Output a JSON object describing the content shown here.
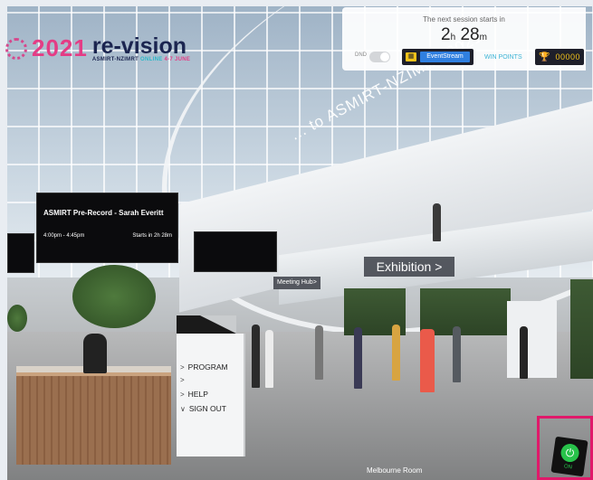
{
  "logo": {
    "year": "2021",
    "brand": "re-vision",
    "sub_org": "ASMIRT-NZIMRT",
    "sub_online": "ONLINE",
    "sub_dates": "4-7 JUNE"
  },
  "session_panel": {
    "next_label": "The next session starts in",
    "hours": "2",
    "hours_unit": "h",
    "minutes": "28",
    "minutes_unit": "m",
    "dnd_label": "DND",
    "dnd_on": false,
    "eventstream_label": "EventStream",
    "win_points_label": "WIN POINTS",
    "points_value": "00000"
  },
  "scene": {
    "welcome_text": "... to ASMIRT-NZIMRT 2021",
    "screen": {
      "title": "ASMIRT Pre-Record - Sarah Everitt",
      "time": "4:00pm - 4:45pm",
      "starts": "Starts in 2h 28m"
    },
    "exhibition_label": "Exhibition",
    "exhibition_chevron": ">",
    "meeting_hub_label": "Meeting Hub>",
    "room_label": "Melbourne Room"
  },
  "menu": {
    "items": [
      {
        "chevron": ">",
        "label": "PROGRAM"
      },
      {
        "chevron": ">",
        "label": ""
      },
      {
        "chevron": ">",
        "label": "HELP"
      },
      {
        "chevron": "∨",
        "label": "SIGN OUT"
      }
    ]
  },
  "power": {
    "icon": "power-icon",
    "label": "ON"
  },
  "colors": {
    "brand_pink": "#e43c85",
    "brand_navy": "#1b2550",
    "accent_blue": "#2f7fe0",
    "gold": "#f2c21a",
    "highlight": "#e0196a",
    "power_green": "#28c24a"
  }
}
